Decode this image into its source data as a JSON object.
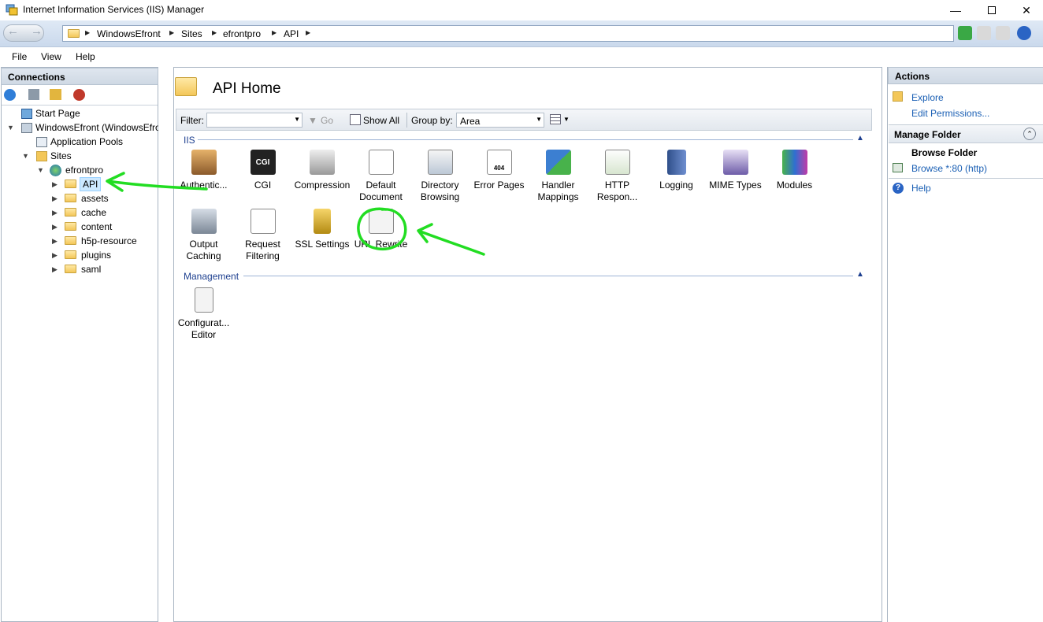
{
  "window": {
    "title": "Internet Information Services (IIS) Manager"
  },
  "breadcrumb": [
    "WindowsEfront",
    "Sites",
    "efrontpro",
    "API"
  ],
  "menu": [
    "File",
    "View",
    "Help"
  ],
  "connections": {
    "header": "Connections",
    "tree": [
      {
        "label": "Start Page"
      },
      {
        "label": "WindowsEfront (WindowsEfro"
      },
      {
        "label": "Application Pools"
      },
      {
        "label": "Sites"
      },
      {
        "label": "efrontpro"
      },
      {
        "label": "API"
      },
      {
        "label": "assets"
      },
      {
        "label": "cache"
      },
      {
        "label": "content"
      },
      {
        "label": "h5p-resource"
      },
      {
        "label": "plugins"
      },
      {
        "label": "saml"
      }
    ]
  },
  "center": {
    "title": "API Home",
    "filter_label": "Filter:",
    "go_label": "Go",
    "show_all_label": "Show All",
    "group_by_label": "Group by:",
    "group_by_value": "Area",
    "sections": {
      "iis": "IIS",
      "management": "Management"
    },
    "iis_features": [
      {
        "label": "Authentic...",
        "icon": "user-lock-icon"
      },
      {
        "label": "CGI",
        "icon": "cgi-icon"
      },
      {
        "label": "Compression",
        "icon": "compression-icon"
      },
      {
        "label": "Default Document",
        "icon": "default-document-icon"
      },
      {
        "label": "Directory Browsing",
        "icon": "directory-browsing-icon"
      },
      {
        "label": "Error Pages",
        "icon": "error-pages-icon"
      },
      {
        "label": "Handler Mappings",
        "icon": "handler-mappings-icon"
      },
      {
        "label": "HTTP Respon...",
        "icon": "http-response-icon"
      },
      {
        "label": "Logging",
        "icon": "logging-icon"
      },
      {
        "label": "MIME Types",
        "icon": "mime-types-icon"
      },
      {
        "label": "Modules",
        "icon": "modules-icon"
      },
      {
        "label": "Output Caching",
        "icon": "output-caching-icon"
      },
      {
        "label": "Request Filtering",
        "icon": "request-filtering-icon"
      },
      {
        "label": "SSL Settings",
        "icon": "ssl-lock-icon"
      },
      {
        "label": "URL Rewrite",
        "icon": "url-rewrite-icon"
      }
    ],
    "management_features": [
      {
        "label": "Configurat... Editor",
        "icon": "configuration-editor-icon"
      }
    ],
    "cgi_badge": "CGI",
    "error_badge": "404"
  },
  "actions": {
    "header": "Actions",
    "explore": "Explore",
    "edit_permissions": "Edit Permissions...",
    "manage_folder": "Manage Folder",
    "browse_folder": "Browse Folder",
    "browse_link": "Browse *:80 (http)",
    "help": "Help"
  },
  "colors": {
    "annotation": "#22dd22",
    "link": "#1a5fb4",
    "section": "#1d3f8f"
  }
}
